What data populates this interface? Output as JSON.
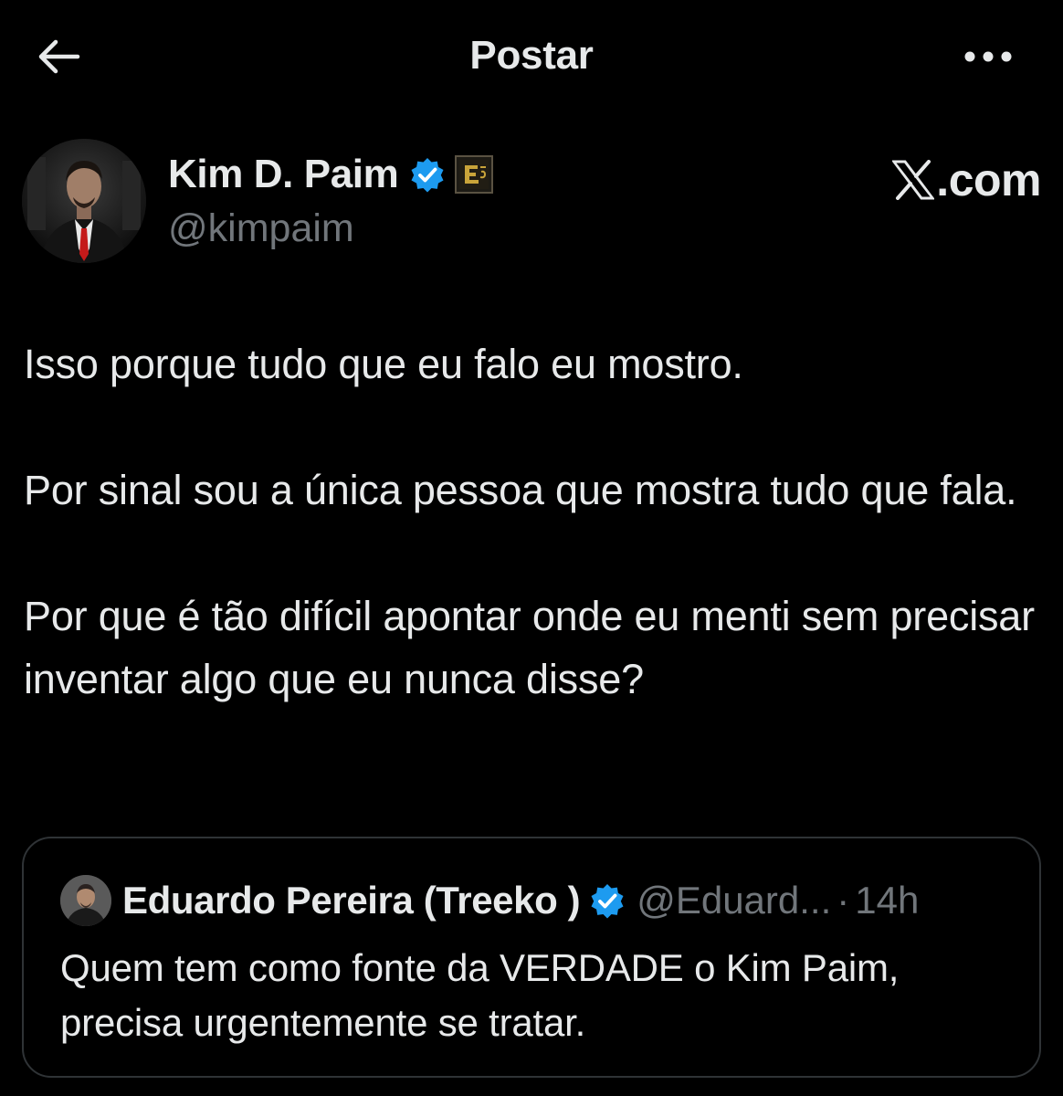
{
  "header": {
    "title": "Postar",
    "back_icon": "arrow-left-icon",
    "more_icon": "ellipsis-horizontal-icon"
  },
  "author": {
    "name": "Kim D. Paim",
    "handle": "@kimpaim",
    "verified_color": "#1d9bf0",
    "watermark": "X.com"
  },
  "post": {
    "paragraphs": [
      "Isso porque tudo que eu falo eu mostro.",
      "Por sinal sou a única pessoa que mostra tudo que fala.",
      "Por que é tão difícil apontar onde eu menti sem precisar inventar algo que eu nunca disse?"
    ]
  },
  "quote": {
    "name": "Eduardo Pereira (Treeko )",
    "handle": "@Eduard...",
    "separator": "·",
    "time": "14h",
    "text": "Quem tem como fonte da VERDADE o Kim Paim, precisa urgentemente se tratar."
  },
  "colors": {
    "background": "#000000",
    "text": "#e7e9ea",
    "secondary": "#71767b",
    "border": "#2f3336",
    "verified": "#1d9bf0"
  }
}
